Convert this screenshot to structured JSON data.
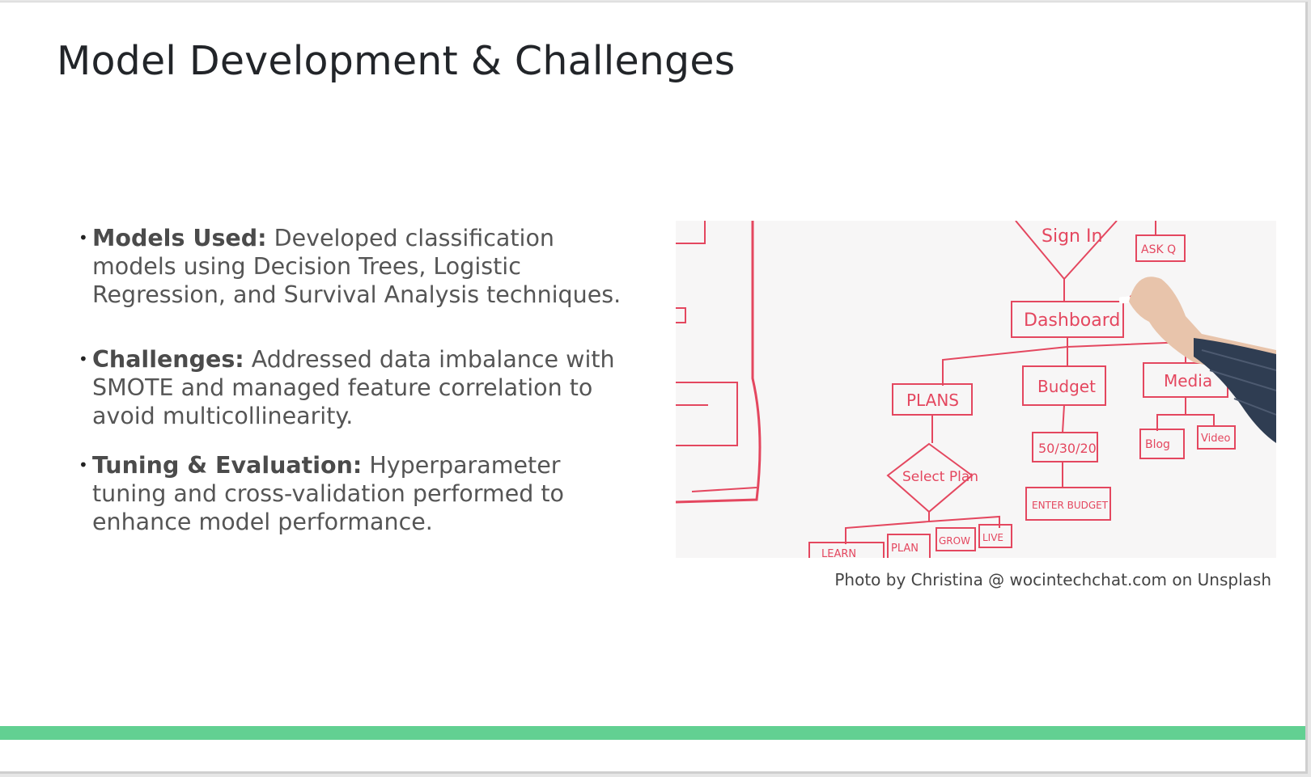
{
  "slide": {
    "title": "Model Development & Challenges",
    "bullets": [
      {
        "lead": "Models Used:",
        "text": " Developed classification models using Decision Trees, Logistic Regression, and Survival Analysis techniques."
      },
      {
        "lead": "Challenges:",
        "text": " Addressed data imbalance with SMOTE and managed feature correlation to avoid multicollinearity."
      },
      {
        "lead": "Tuning & Evaluation:",
        "text": " Hyperparameter tuning and cross-validation performed to enhance model performance."
      }
    ],
    "bullet_glyph": "•",
    "photo": {
      "whiteboard_labels": [
        "Sign In",
        "ASK Q",
        "Dashboard",
        "PLANS",
        "Budget",
        "Media",
        "Select Plan",
        "50/30/20",
        "Blog",
        "Video",
        "ENTER BUDGET",
        "LEARN",
        "PLAN",
        "GROW",
        "LIVE"
      ],
      "ink_color": "#e4475f"
    },
    "caption": "Photo by Christina @ wocintechchat.com on Unsplash",
    "accent_color": "#62d092"
  }
}
